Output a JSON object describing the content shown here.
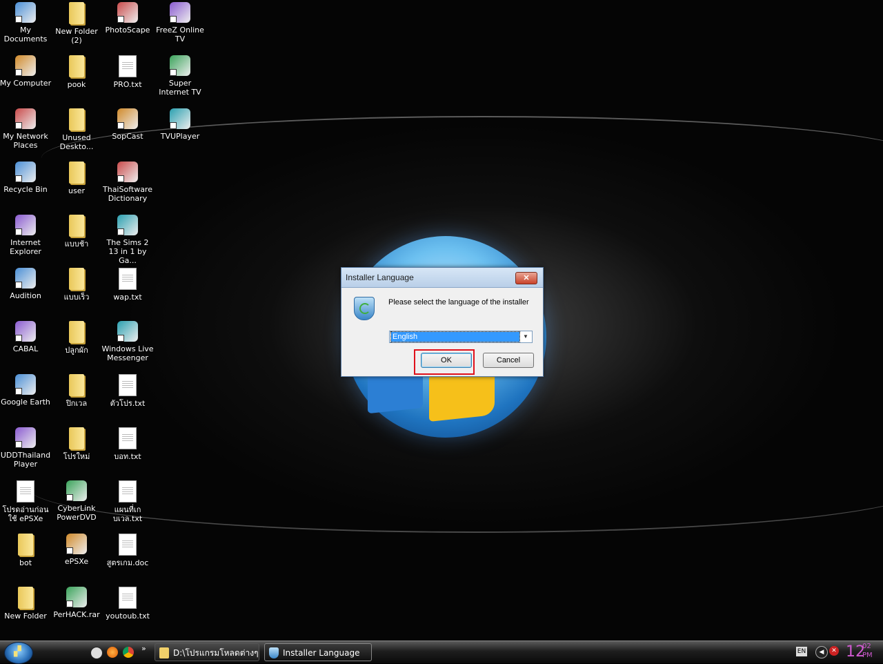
{
  "desktop": {
    "icons": [
      {
        "label": "My Documents",
        "icon": "my-documents-icon",
        "type": "app"
      },
      {
        "label": "New Folder (2)",
        "icon": "folder-icon",
        "type": "folder"
      },
      {
        "label": "PhotoScape",
        "icon": "photoscape-icon",
        "type": "app"
      },
      {
        "label": "FreeZ Online TV",
        "icon": "freez-tv-icon",
        "type": "app"
      },
      {
        "label": "My Computer",
        "icon": "computer-icon",
        "type": "app"
      },
      {
        "label": "pook",
        "icon": "folder-icon",
        "type": "folder"
      },
      {
        "label": "PRO.txt",
        "icon": "text-file-icon",
        "type": "doc"
      },
      {
        "label": "Super Internet TV",
        "icon": "super-internet-tv-icon",
        "type": "app"
      },
      {
        "label": "My Network Places",
        "icon": "network-icon",
        "type": "app"
      },
      {
        "label": "Unused Deskto...",
        "icon": "folder-icon",
        "type": "folder"
      },
      {
        "label": "SopCast",
        "icon": "sopcast-icon",
        "type": "app"
      },
      {
        "label": "TVUPlayer",
        "icon": "tvuplayer-icon",
        "type": "app"
      },
      {
        "label": "Recycle Bin",
        "icon": "recycle-bin-icon",
        "type": "app"
      },
      {
        "label": "user",
        "icon": "folder-icon",
        "type": "folder"
      },
      {
        "label": "ThaiSoftware Dictionary",
        "icon": "thaisoftware-icon",
        "type": "app"
      },
      {
        "label": "Internet Explorer",
        "icon": "internet-explorer-icon",
        "type": "app"
      },
      {
        "label": "แบบช้า",
        "icon": "folder-icon",
        "type": "folder"
      },
      {
        "label": "The Sims 2 13 in 1 by Ga...",
        "icon": "sims-icon",
        "type": "app"
      },
      {
        "label": "Audition",
        "icon": "audition-icon",
        "type": "app"
      },
      {
        "label": "แบบเร็ว",
        "icon": "folder-icon",
        "type": "folder"
      },
      {
        "label": "wap.txt",
        "icon": "text-file-icon",
        "type": "doc"
      },
      {
        "label": "CABAL",
        "icon": "cabal-icon",
        "type": "app"
      },
      {
        "label": "ปลูกผัก",
        "icon": "folder-icon",
        "type": "folder"
      },
      {
        "label": "Windows Live Messenger",
        "icon": "messenger-icon",
        "type": "app"
      },
      {
        "label": "Google Earth",
        "icon": "google-earth-icon",
        "type": "app"
      },
      {
        "label": "ปิกเวล",
        "icon": "folder-icon",
        "type": "folder"
      },
      {
        "label": "ตัวโปร.txt",
        "icon": "text-file-icon",
        "type": "doc"
      },
      {
        "label": "UDDThailand Player",
        "icon": "uddthailand-icon",
        "type": "app"
      },
      {
        "label": "โปรใหม่",
        "icon": "folder-icon",
        "type": "folder"
      },
      {
        "label": "บอท.txt",
        "icon": "text-file-icon",
        "type": "doc"
      },
      {
        "label": "โปรดอ่านก่อน ใช้ ePSXe",
        "icon": "shortcut-file-icon",
        "type": "doc"
      },
      {
        "label": "CyberLink PowerDVD",
        "icon": "powerdvd-icon",
        "type": "app"
      },
      {
        "label": "แผนที่เก บเวล.txt",
        "icon": "text-file-icon",
        "type": "doc"
      },
      {
        "label": "bot",
        "icon": "folder-icon",
        "type": "folder"
      },
      {
        "label": "ePSXe",
        "icon": "epsxe-icon",
        "type": "app"
      },
      {
        "label": "สูตรเกม.doc",
        "icon": "word-doc-icon",
        "type": "doc"
      },
      {
        "label": "New Folder",
        "icon": "folder-icon",
        "type": "folder"
      },
      {
        "label": "PerHACK.rar",
        "icon": "rar-archive-icon",
        "type": "app"
      },
      {
        "label": "youtoub.txt",
        "icon": "text-file-icon",
        "type": "doc"
      }
    ]
  },
  "dialog": {
    "title": "Installer Language",
    "close_label": "✕",
    "message": "Please select the language of the installer",
    "language_selected": "English",
    "ok_label": "OK",
    "cancel_label": "Cancel"
  },
  "taskbar": {
    "quick_launch_more": "»",
    "tasks": [
      {
        "label": "D:\\โปรแกรมโหลดต่างๆ"
      },
      {
        "label": "Installer Language"
      }
    ],
    "tray": {
      "language": "EN",
      "clock_hour": "12",
      "clock_minute": "02",
      "clock_ampm": "PM"
    }
  },
  "colors": {
    "highlight_box": "#e0101a",
    "selection": "#3399ff",
    "clock": "#d05ad0"
  }
}
